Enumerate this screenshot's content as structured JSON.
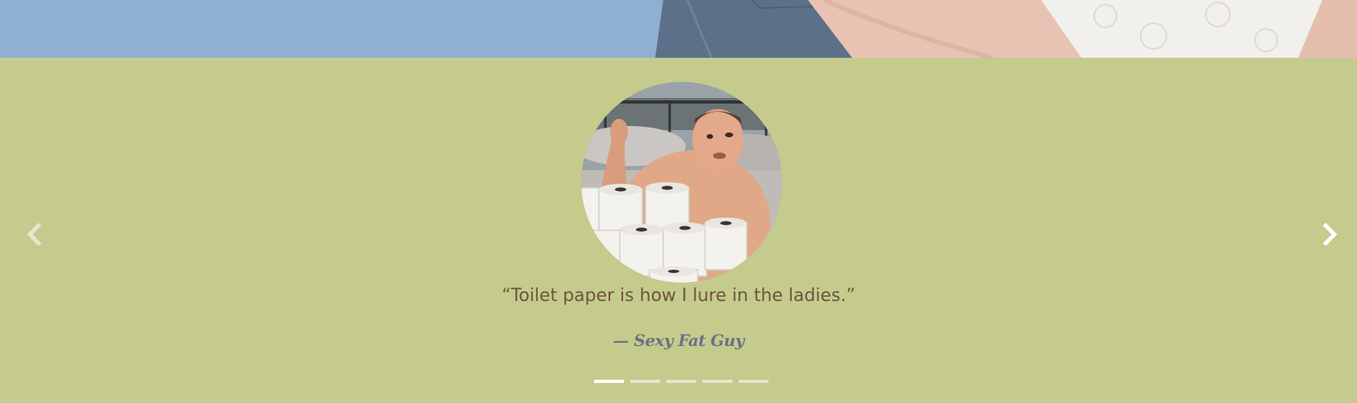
{
  "hero": {
    "background_color": "#90b0d2"
  },
  "testimonial": {
    "quote": "“Toilet paper is how I lure in the ladies.”",
    "author": "— Sexy Fat Guy",
    "avatar_description_icon": "testimonial-photo"
  },
  "carousel": {
    "prev_icon": "chevron-left-icon",
    "next_icon": "chevron-right-icon",
    "slide_count": 5,
    "active_index": 0
  },
  "colors": {
    "section_background": "#c4cb8c",
    "quote_text": "#6e5440",
    "author_text": "#6c7185",
    "indicator_active": "#ffffff"
  }
}
